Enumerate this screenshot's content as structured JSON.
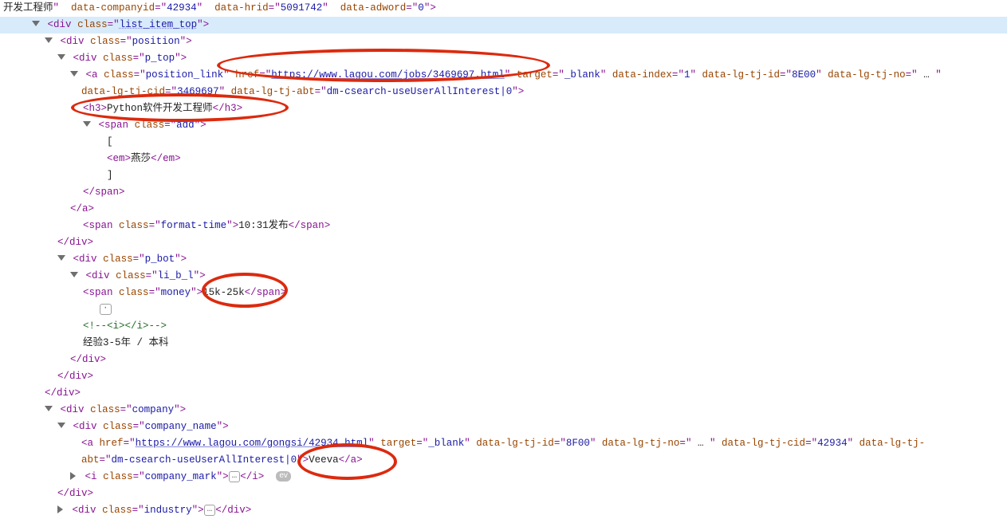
{
  "code": {
    "line1_fragment": {
      "text_before": "开发工程师",
      "attr1_name": "data-companyid",
      "attr1_val": "42934",
      "attr2_name": "data-hrid",
      "attr2_val": "5091742",
      "attr3_name": "data-adword",
      "attr3_val": "0"
    },
    "list_item_top": {
      "tag": "div",
      "class_attr": "class",
      "class_val": "list_item_top"
    },
    "position_div": {
      "tag": "div",
      "class_attr": "class",
      "class_val": "position"
    },
    "p_top": {
      "tag": "div",
      "class_attr": "class",
      "class_val": "p_top"
    },
    "position_a": {
      "tag": "a",
      "class_attr": "class",
      "class_val": "position_link",
      "href_attr": "href",
      "href_val": "https://www.lagou.com/jobs/3469697.html",
      "target_attr": "target",
      "target_val": "_blank",
      "di_attr": "data-index",
      "di_val": "1",
      "id_attr": "data-lg-tj-id",
      "id_val": "8E00",
      "no_attr": "data-lg-tj-no",
      "no_val": "",
      "ellips": "…",
      "cid_attr": "data-lg-tj-cid",
      "cid_val": "3469697",
      "abt_attr": "data-lg-tj-abt",
      "abt_val": "dm-csearch-useUserAllInterest|0"
    },
    "h3": {
      "tag": "h3",
      "text": "Python软件开发工程师"
    },
    "add_span": {
      "tag": "span",
      "class_attr": "class",
      "class_val": "add",
      "open_bracket": "[",
      "em_tag": "em",
      "em_text": "燕莎",
      "close_bracket": "]"
    },
    "format_time": {
      "tag": "span",
      "class_attr": "class",
      "class_val": "format-time",
      "text": "10:31发布"
    },
    "p_bot": {
      "tag": "div",
      "class_attr": "class",
      "class_val": "p_bot"
    },
    "li_b_l": {
      "tag": "div",
      "class_attr": "class",
      "class_val": "li_b_l"
    },
    "money": {
      "tag": "span",
      "class_attr": "class",
      "class_val": "money",
      "text": "15k-25k"
    },
    "i_comment": "<!--<i></i>-->",
    "exp_text": "经验3-5年 / 本科",
    "company_div": {
      "tag": "div",
      "class_attr": "class",
      "class_val": "company"
    },
    "company_name_div": {
      "tag": "div",
      "class_attr": "class",
      "class_val": "company_name"
    },
    "company_a": {
      "tag": "a",
      "href_attr": "href",
      "href_val": "https://www.lagou.com/gongsi/42934.html",
      "target_attr": "target",
      "target_val": "_blank",
      "id_attr": "data-lg-tj-id",
      "id_val": "8F00",
      "no_attr": "data-lg-tj-no",
      "no_val": "",
      "ellips": "…",
      "cid_attr": "data-lg-tj-cid",
      "cid_val": "42934",
      "abt_attr": "data-lg-tj-abt",
      "abt_val": "dm-csearch-useUserAllInterest|0",
      "text": "Veeva"
    },
    "company_mark_i": {
      "tag": "i",
      "class_attr": "class",
      "class_val": "company_mark",
      "expand": "…",
      "ev": "ev"
    },
    "industry": {
      "tag": "div",
      "class_attr": "class",
      "class_val": "industry",
      "expand": "…"
    }
  },
  "close": {
    "div": "div",
    "a": "a",
    "span": "span"
  }
}
